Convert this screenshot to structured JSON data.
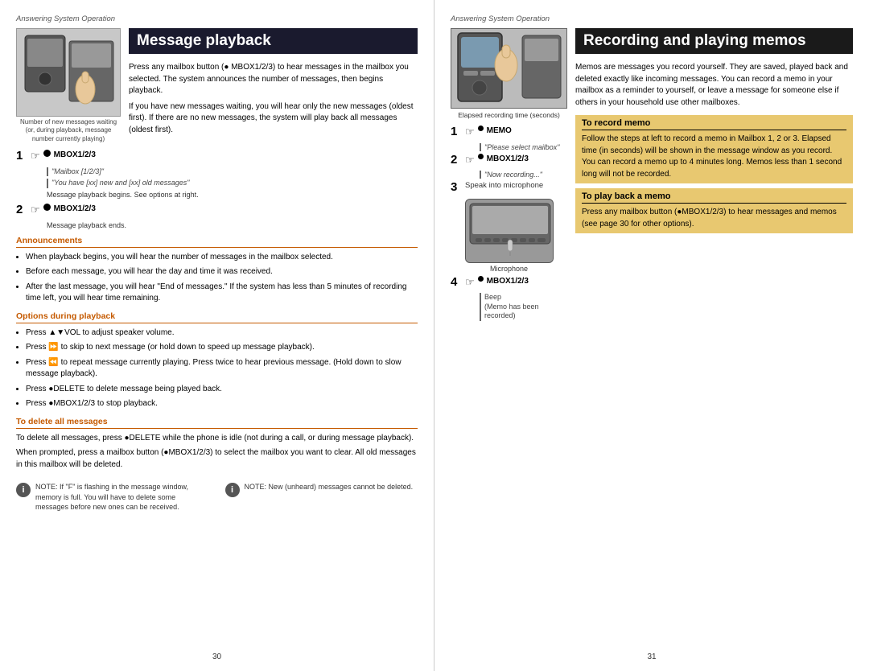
{
  "left_page": {
    "section_header": "Answering System Operation",
    "title": "Message playback",
    "device_caption": "Number of new messages waiting (or, during playback, message number currently playing)",
    "intro": "Press any mailbox button (● MBOX1/2/3) to hear messages in the mailbox you selected. The system announces the number of messages, then begins playback.",
    "intro2": "If you have new messages waiting, you will hear only the new messages (oldest first). If there are no new messages, the system will play back all messages (oldest first).",
    "step1": {
      "num": "1",
      "icon": "finger",
      "label": "MBOX1/2/3",
      "sublabel": "\"Mailbox [1/2/3]\""
    },
    "step1b": {
      "sublabel": "\"You have [xx] new and [xx] old messages\""
    },
    "step1_note": "Message playback begins. See options at right.",
    "step2": {
      "num": "2",
      "icon": "finger",
      "label": "MBOX1/2/3"
    },
    "step2_note": "Message playback ends.",
    "announcements_title": "Announcements",
    "announcements": [
      "When playback begins, you will hear the number of messages in the mailbox selected.",
      "Before each message, you will hear the day and time it was received.",
      "After the last message, you will hear \"End of messages.\" If the system has less than 5 minutes of recording time left, you will hear time remaining."
    ],
    "options_title": "Options during playback",
    "options": [
      "Press ▲▼VOL to adjust speaker volume.",
      "Press ⏩ to skip to next message (or hold down to speed up message playback).",
      "Press ⏪ to repeat message currently playing. Press twice to hear previous message. (Hold down to slow message playback).",
      "Press ●DELETE to delete message being played back.",
      "Press ●MBOX1/2/3 to stop playback."
    ],
    "delete_title": "To delete all messages",
    "delete_text": "To delete all messages, press ●DELETE while the phone is idle (not during a call, or during message playback).",
    "delete_text2": "When prompted, press a mailbox button (●MBOX1/2/3) to select the mailbox you want to clear. All old messages in this mailbox will be deleted.",
    "note1": {
      "icon": "i",
      "text": "NOTE: If \"F\" is flashing in the message window, memory is full. You will have to delete some messages before new ones can be received."
    },
    "note2": {
      "icon": "i",
      "text": "NOTE: New (unheard) messages cannot be deleted."
    },
    "page_number": "30"
  },
  "right_page": {
    "section_header": "Answering System Operation",
    "title": "Recording and playing memos",
    "elapsed_label": "Elapsed recording time (seconds)",
    "intro": "Memos are messages you record yourself. They are saved, played back and deleted exactly like incoming messages. You can record a memo in your mailbox as a reminder to yourself, or leave a message for someone else if others in your household use other mailboxes.",
    "to_record_title": "To record memo",
    "to_record_detail": "Follow the steps at left to record a memo in Mailbox 1, 2 or 3. Elapsed time (in seconds) will be shown in the message window as you record. You can record a memo up to 4 minutes long. Memos less than 1 second long will not be recorded.",
    "to_play_title": "To play back a memo",
    "to_play_detail": "Press any mailbox button (●MBOX1/2/3) to hear messages and memos (see page 30 for other options).",
    "step1": {
      "num": "1",
      "icon": "finger",
      "label": "MEMO",
      "sublabel": "\"Please select mailbox\""
    },
    "step2": {
      "num": "2",
      "icon": "finger",
      "label": "MBOX1/2/3",
      "sublabel": "\"Now recording...\""
    },
    "step3": {
      "num": "3",
      "text": "Speak into microphone"
    },
    "step4": {
      "num": "4",
      "icon": "finger",
      "label": "MBOX1/2/3",
      "sublabel1": "Beep",
      "sublabel2": "(Memo has been recorded)"
    },
    "microphone_label": "Microphone",
    "page_number": "31"
  }
}
